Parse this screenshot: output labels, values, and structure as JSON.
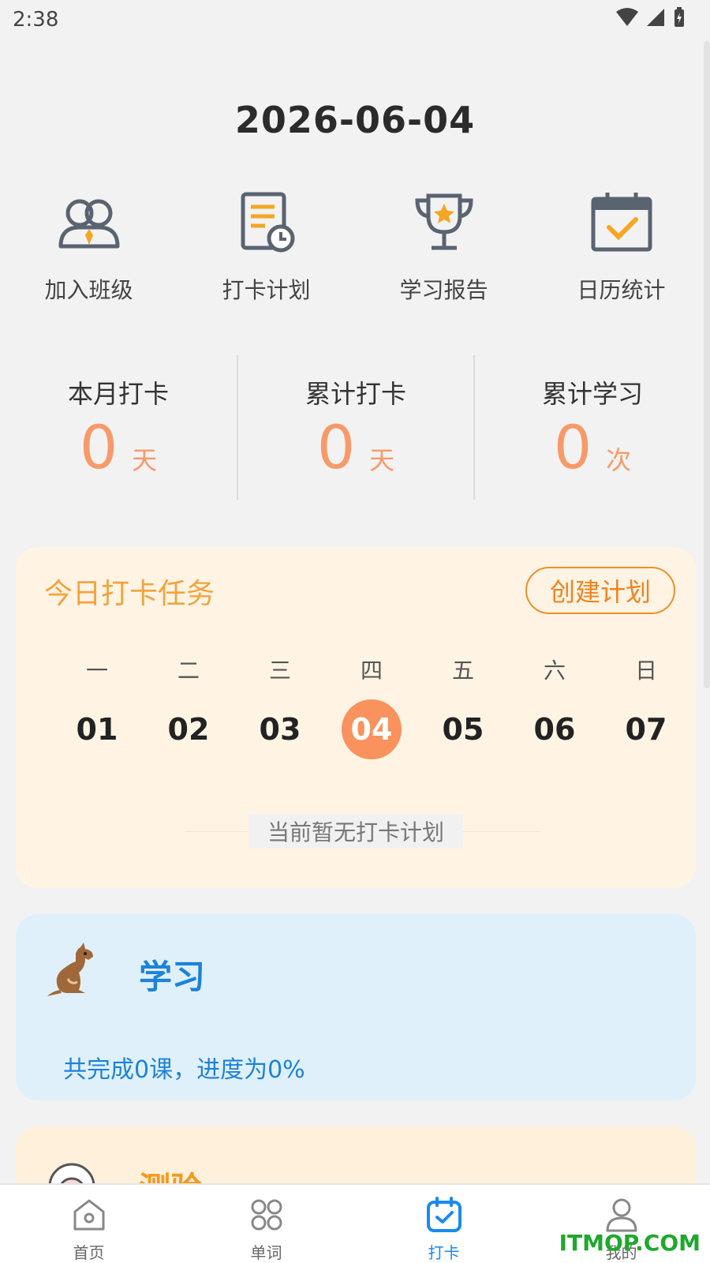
{
  "status_bar": {
    "time": "2:38"
  },
  "date": "2026-06-04",
  "quick_actions": [
    {
      "label": "加入班级",
      "icon": "people-icon"
    },
    {
      "label": "打卡计划",
      "icon": "plan-clock-icon"
    },
    {
      "label": "学习报告",
      "icon": "trophy-star-icon"
    },
    {
      "label": "日历统计",
      "icon": "calendar-check-icon"
    }
  ],
  "stats": [
    {
      "title": "本月打卡",
      "value": "0",
      "unit": "天"
    },
    {
      "title": "累计打卡",
      "value": "0",
      "unit": "天"
    },
    {
      "title": "累计学习",
      "value": "0",
      "unit": "次"
    }
  ],
  "task_card": {
    "title": "今日打卡任务",
    "create_button": "创建计划",
    "weekdays": [
      "一",
      "二",
      "三",
      "四",
      "五",
      "六",
      "日"
    ],
    "dates": [
      "01",
      "02",
      "03",
      "04",
      "05",
      "06",
      "07"
    ],
    "active_index": 3,
    "empty_text": "当前暂无打卡计划"
  },
  "study_card": {
    "title": "学习",
    "progress_text": "共完成0课，进度为0%"
  },
  "quiz_card": {
    "title": "测验"
  },
  "bottom_nav": [
    {
      "label": "首页",
      "icon": "home-icon"
    },
    {
      "label": "单词",
      "icon": "grid-icon"
    },
    {
      "label": "打卡",
      "icon": "checkin-calendar-icon",
      "active": true
    },
    {
      "label": "我的",
      "icon": "profile-icon"
    }
  ],
  "watermark": "ITMOP.COM",
  "colors": {
    "accent_orange": "#f79a6a",
    "active_date_bg": "#f9925d",
    "task_title": "#f4a23d",
    "study_blue": "#1d82d8",
    "nav_active": "#1a8af0"
  }
}
